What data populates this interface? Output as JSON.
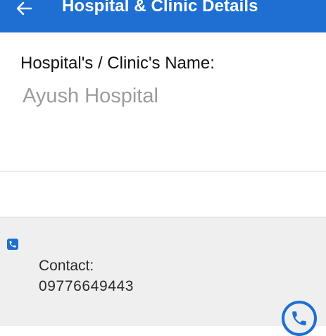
{
  "app_bar": {
    "title": "Hospital & Clinic Details",
    "back_icon": "arrow-left-icon",
    "color": "#1e6fd1"
  },
  "hospital": {
    "label": "Hospital's / Clinic's Name:",
    "value": "Ayush Hospital"
  },
  "contact": {
    "badge_icon": "phone-icon",
    "label": "Contact:",
    "number": "09776649443",
    "call_icon": "phone-circle-icon"
  }
}
